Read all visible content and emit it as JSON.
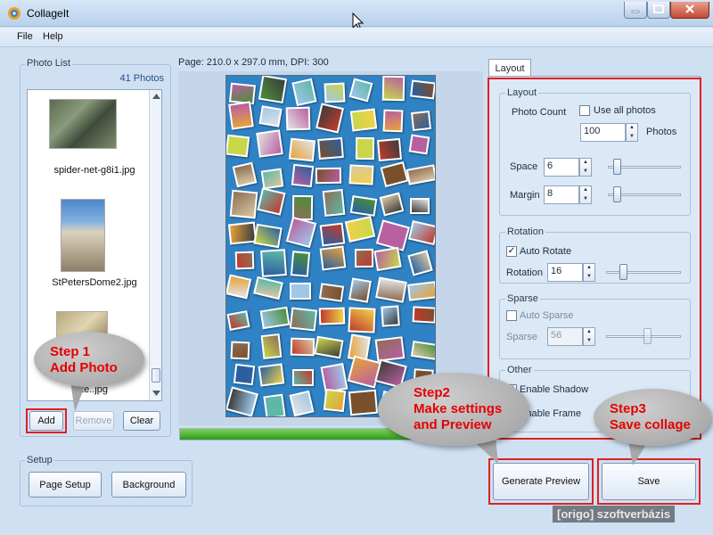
{
  "window": {
    "title": "CollageIt"
  },
  "menu": [
    {
      "label": "File"
    },
    {
      "label": "Help"
    }
  ],
  "photo_list": {
    "group_label": "Photo List",
    "count": "41 Photos",
    "files": [
      {
        "name": "spider-net-g8i1.jpg"
      },
      {
        "name": "StPetersDome2.jpg"
      },
      {
        "name": "te..jpg"
      }
    ],
    "buttons": {
      "add": "Add",
      "remove": "Remove",
      "clear": "Clear"
    }
  },
  "setup": {
    "group_label": "Setup",
    "page_setup": "Page Setup",
    "background": "Background"
  },
  "page_info": "Page: 210.0 x 297.0 mm, DPI: 300",
  "progress": {
    "value": 100
  },
  "layout_tab": {
    "tab_label": "Layout",
    "layout": {
      "group_label": "Layout",
      "photo_count_label": "Photo Count",
      "use_all_label": "Use all photos",
      "use_all_checked": false,
      "photo_count_value": "100",
      "photos_unit": "Photos",
      "space_label": "Space",
      "space_value": "6",
      "space_slider": 0.08,
      "margin_label": "Margin",
      "margin_value": "8",
      "margin_slider": 0.08
    },
    "rotation": {
      "group_label": "Rotation",
      "auto_rotate_label": "Auto Rotate",
      "auto_rotate_checked": true,
      "rotation_label": "Rotation",
      "rotation_value": "16",
      "rotation_slider": 0.2
    },
    "sparse": {
      "group_label": "Sparse",
      "auto_sparse_label": "Auto Sparse",
      "auto_sparse_checked": false,
      "sparse_label": "Sparse",
      "sparse_value": "56",
      "sparse_slider": 0.56
    },
    "other": {
      "group_label": "Other",
      "enable_shadow_label": "Enable Shadow",
      "enable_shadow_checked": true,
      "frame_label": "Enable Frame",
      "frame_checked": true
    }
  },
  "actions": {
    "generate_preview": "Generate Preview",
    "save": "Save"
  },
  "callouts": {
    "step1": {
      "line1": "Step 1",
      "line2": "Add Photo"
    },
    "step2": {
      "line1": "Step2",
      "line2": "Make settings",
      "line3": "and Preview"
    },
    "step3": {
      "line1": "Step3",
      "line2": "Save collage"
    }
  },
  "watermark": "[origo] szoftverbázis",
  "colors": {
    "highlight_red": "#e21f1f",
    "callout_text": "#e60000",
    "collage_bg": "#2f82c4",
    "progress_green": "#3aa524"
  }
}
